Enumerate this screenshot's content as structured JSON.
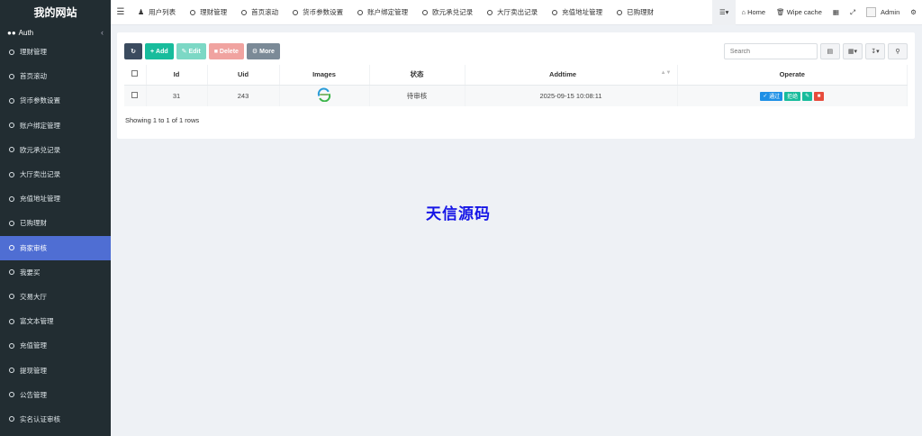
{
  "sidebar": {
    "logo": "我的网站",
    "auth_label": "Auth",
    "items": [
      {
        "label": "理财管理",
        "active": false
      },
      {
        "label": "首页滚动",
        "active": false
      },
      {
        "label": "货币参数设置",
        "active": false
      },
      {
        "label": "账户绑定管理",
        "active": false
      },
      {
        "label": "欧元承兑记录",
        "active": false
      },
      {
        "label": "大厅卖出记录",
        "active": false
      },
      {
        "label": "充值地址管理",
        "active": false
      },
      {
        "label": "已购理财",
        "active": false
      },
      {
        "label": "商家审核",
        "active": true
      },
      {
        "label": "我要买",
        "active": false
      },
      {
        "label": "交易大厅",
        "active": false
      },
      {
        "label": "富文本管理",
        "active": false
      },
      {
        "label": "充值管理",
        "active": false
      },
      {
        "label": "提现管理",
        "active": false
      },
      {
        "label": "公告管理",
        "active": false
      },
      {
        "label": "实名认证审核",
        "active": false
      }
    ]
  },
  "topbar": {
    "tabs": [
      "用户列表",
      "理财管理",
      "首页滚动",
      "货币参数设置",
      "账户绑定管理",
      "欧元承兑记录",
      "大厅卖出记录",
      "充值地址管理",
      "已购理财"
    ],
    "home": "Home",
    "wipe_cache": "Wipe cache",
    "admin": "Admin"
  },
  "toolbar": {
    "add": "Add",
    "edit": "Edit",
    "delete": "Delete",
    "more": "More",
    "search_placeholder": "Search"
  },
  "table": {
    "headers": {
      "id": "Id",
      "uid": "Uid",
      "images": "Images",
      "status": "状态",
      "addtime": "Addtime",
      "operate": "Operate"
    },
    "rows": [
      {
        "id": "31",
        "uid": "243",
        "status": "待审核",
        "addtime": "2025-09-15 10:08:11",
        "op_pass": "通过",
        "op_reject": "拒绝"
      }
    ],
    "showing": "Showing 1 to 1 of 1 rows"
  },
  "watermark": "天信源码",
  "colors": {
    "sidebar_bg": "#222d32",
    "active_item": "#4f6ed3",
    "success": "#18bc9c",
    "primary": "#1e90e6",
    "danger": "#e74c3c"
  }
}
